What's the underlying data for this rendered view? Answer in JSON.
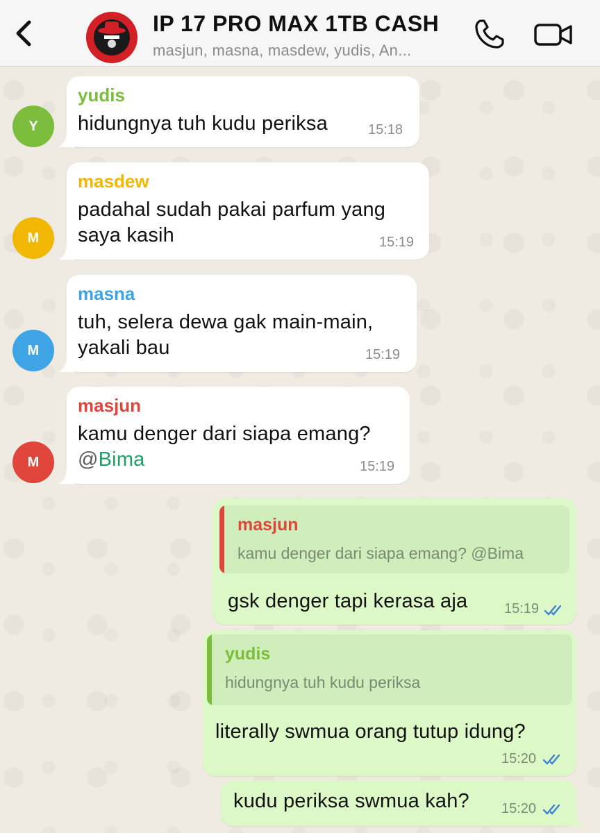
{
  "header": {
    "title": "IP 17 PRO MAX 1TB CASH",
    "participants": "masjun, masna, masdew, yudis, An..."
  },
  "colors": {
    "yudis": "#7cbd3d",
    "masdew": "#f2b705",
    "masna": "#3ea4e6",
    "masjun": "#e0453b",
    "outgoing_bubble": "#dcf8c6",
    "incoming_bubble": "#ffffff",
    "read_ticks": "#3b82d6"
  },
  "messages": [
    {
      "sender": "yudis",
      "avatar_initial": "Y",
      "lines": [
        "hidungnya tuh kudu periksa"
      ],
      "time": "15:18"
    },
    {
      "sender": "masdew",
      "avatar_initial": "M",
      "lines": [
        "padahal sudah pakai parfum yang",
        "saya kasih"
      ],
      "time": "15:19"
    },
    {
      "sender": "masna",
      "avatar_initial": "M",
      "lines": [
        "tuh, selera dewa gak main-main,",
        "yakali bau"
      ],
      "time": "15:19"
    },
    {
      "sender": "masjun",
      "avatar_initial": "M",
      "line1": "kamu denger dari siapa emang?",
      "mention_at": "@",
      "mention_name": "Bima",
      "time": "15:19"
    }
  ],
  "outgoing": [
    {
      "reply_sender": "masjun",
      "reply_text": "kamu denger dari siapa emang? @Bima",
      "text": "gsk denger tapi kerasa aja",
      "time": "15:19",
      "status": "read"
    },
    {
      "reply_sender": "yudis",
      "reply_text": "hidungnya tuh kudu periksa",
      "text": "literally swmua orang tutup idung?",
      "time": "15:20",
      "status": "read"
    },
    {
      "text": "kudu periksa swmua kah?",
      "time": "15:20",
      "status": "read"
    }
  ],
  "icons": {
    "back": "chevron-left-icon",
    "call": "phone-icon",
    "video": "video-camera-icon",
    "read": "double-check-icon"
  }
}
